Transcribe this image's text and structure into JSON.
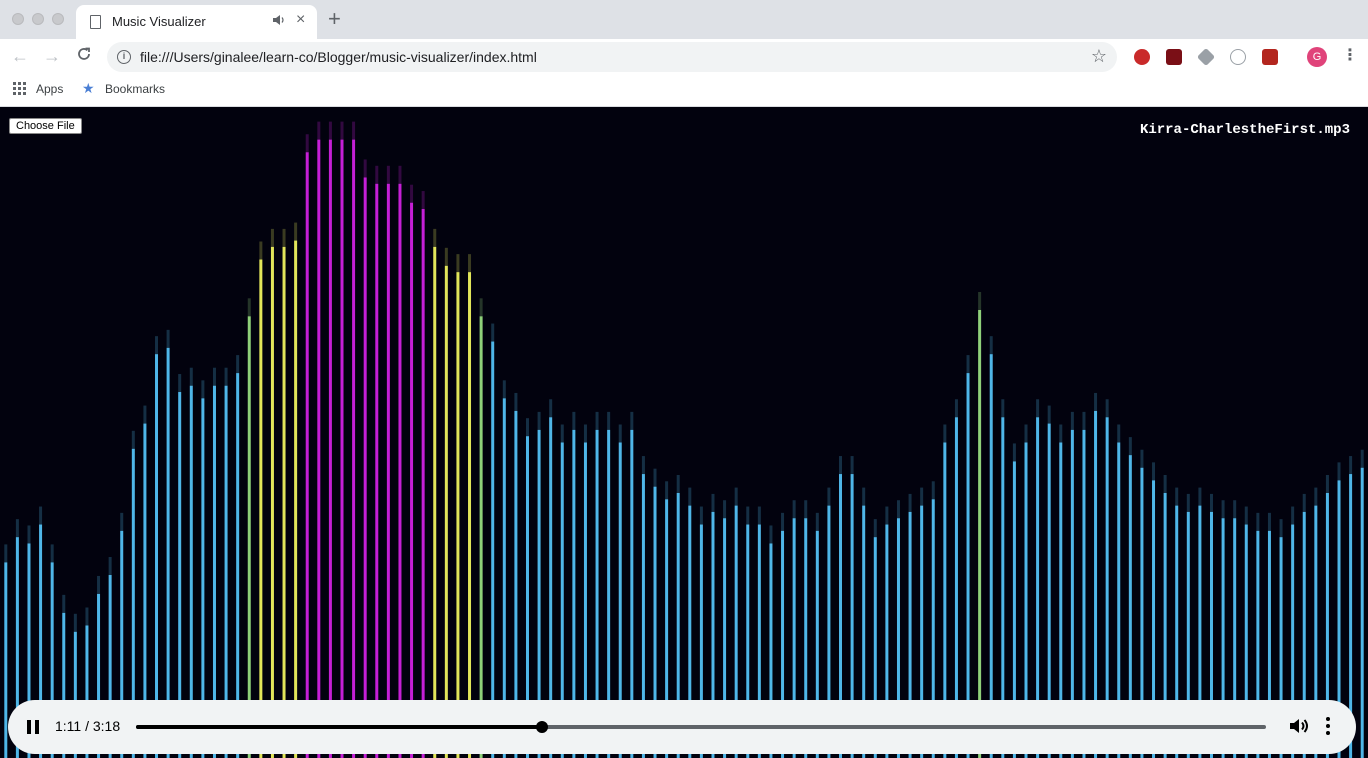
{
  "browser": {
    "tab_title": "Music Visualizer",
    "tab_audio_icon": "speaker-icon",
    "tab_close": "×",
    "new_tab": "+",
    "url": "file:///Users/ginalee/learn-co/Blogger/music-visualizer/index.html",
    "avatar_letter": "G",
    "bookmarks": [
      "Apps",
      "Bookmarks"
    ]
  },
  "page": {
    "choose_file_label": "Choose File",
    "track_name": "Kirra-CharlestheFirst.mp3"
  },
  "player": {
    "time": "1:11 / 3:18",
    "progress_fraction": 0.359
  },
  "visualizer": {
    "color_low": "#4fb6e8",
    "color_mid_green": "#8fd17a",
    "color_mid_yellow": "#e2e65a",
    "color_high": "#c51fd6",
    "background": "#02020e",
    "levels": [
      0.31,
      0.35,
      0.34,
      0.37,
      0.31,
      0.23,
      0.2,
      0.21,
      0.26,
      0.29,
      0.36,
      0.49,
      0.53,
      0.64,
      0.65,
      0.58,
      0.59,
      0.57,
      0.59,
      0.59,
      0.61,
      0.7,
      0.79,
      0.81,
      0.81,
      0.82,
      0.96,
      0.98,
      0.98,
      0.98,
      0.98,
      0.92,
      0.91,
      0.91,
      0.91,
      0.88,
      0.87,
      0.81,
      0.78,
      0.77,
      0.77,
      0.7,
      0.66,
      0.57,
      0.55,
      0.51,
      0.52,
      0.54,
      0.5,
      0.52,
      0.5,
      0.52,
      0.52,
      0.5,
      0.52,
      0.45,
      0.43,
      0.41,
      0.42,
      0.4,
      0.37,
      0.39,
      0.38,
      0.4,
      0.37,
      0.37,
      0.34,
      0.36,
      0.38,
      0.38,
      0.36,
      0.4,
      0.45,
      0.45,
      0.4,
      0.35,
      0.37,
      0.38,
      0.39,
      0.4,
      0.41,
      0.5,
      0.54,
      0.61,
      0.71,
      0.64,
      0.54,
      0.47,
      0.5,
      0.54,
      0.53,
      0.5,
      0.52,
      0.52,
      0.55,
      0.54,
      0.5,
      0.48,
      0.46,
      0.44,
      0.42,
      0.4,
      0.39,
      0.4,
      0.39,
      0.38,
      0.38,
      0.37,
      0.36,
      0.36,
      0.35,
      0.37,
      0.39,
      0.4,
      0.42,
      0.44,
      0.45,
      0.46
    ]
  }
}
